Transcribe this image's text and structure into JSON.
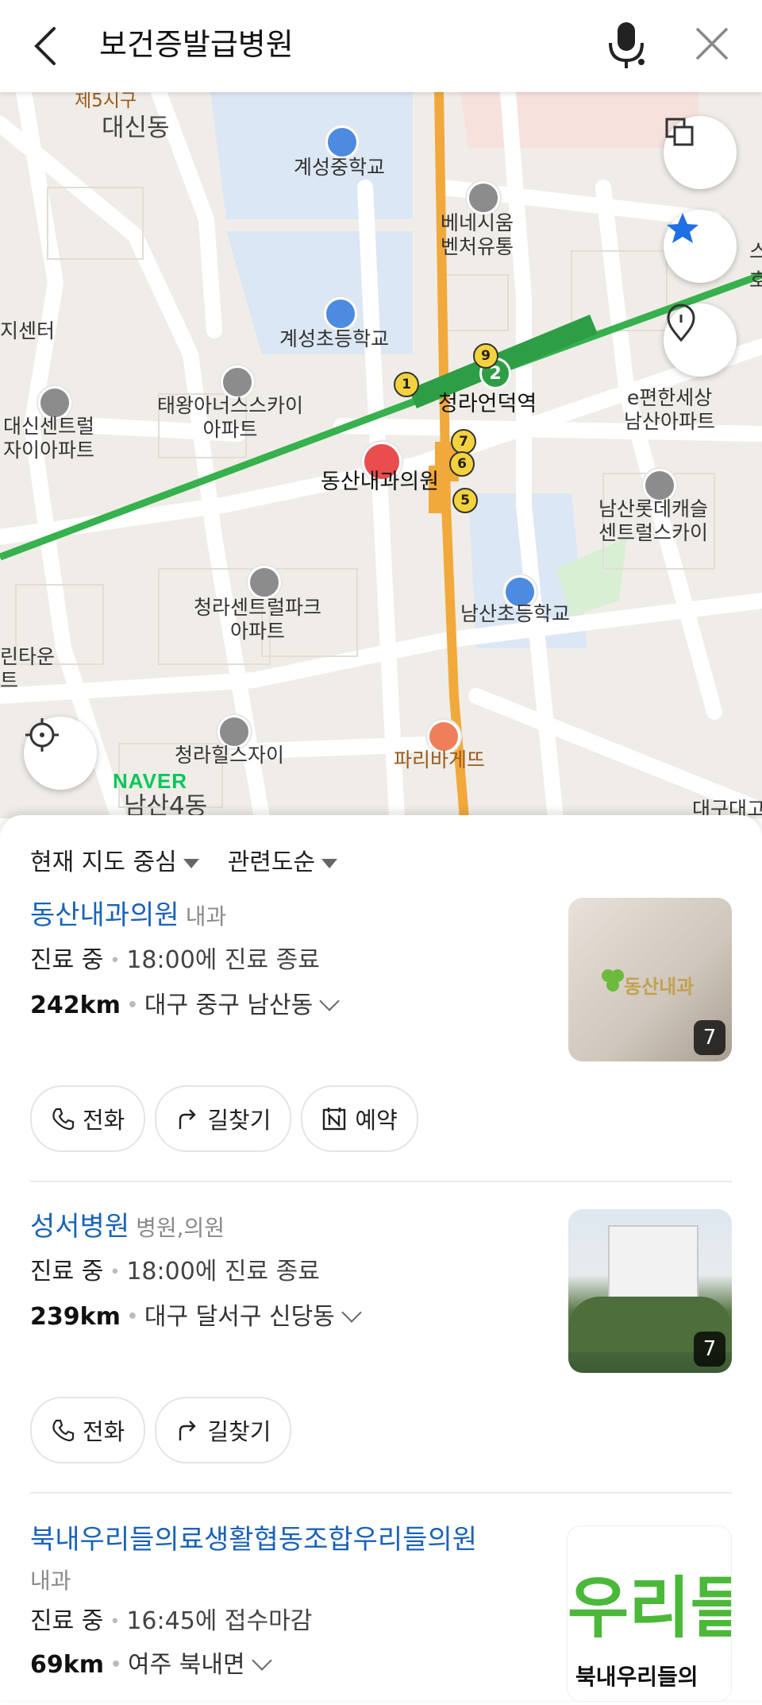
{
  "topbar": {
    "query": "보건증발급병원"
  },
  "map": {
    "labels": {
      "je5sigu": "제5시구",
      "daesindong": "대신동",
      "gyeseong_middle": "계성중학교",
      "benesium": "베네시움\n벤처유통",
      "jisenteo": "지센터",
      "gyeseong_elem": "계성초등학교",
      "taewang": "태왕아너스스카이\n아파트",
      "daesin_central": "대신센트럴\n자이아파트",
      "cheongna_station": "청라언덕역",
      "e_pyeonhan": "e편한세상\n남산아파트",
      "dongsan_clinic": "동산내과의원",
      "namsan_lotte": "남산롯데캐슬\n센트럴스카이",
      "cheongna_central": "청라센트럴파크\n아파트",
      "namsan_elem": "남산초등학교",
      "rin_town": "린타운\n트",
      "cheongna_hills": "청라힐스자이",
      "paris": "파리바게뜨",
      "namsan4": "남산4동",
      "daegu_right": "대구대고",
      "right_ho": "호",
      "right_s": "스"
    },
    "station_numbers": [
      "1",
      "2",
      "9",
      "7",
      "6",
      "5"
    ],
    "logo": "NAVER"
  },
  "sheet": {
    "filters": [
      {
        "label": "현재 지도 중심"
      },
      {
        "label": "관련도순"
      }
    ],
    "results": [
      {
        "name": "동산내과의원",
        "category": "내과",
        "status": "진료 중",
        "status_detail": "18:00에 진료 종료",
        "distance": "242km",
        "address": "대구 중구 남산동",
        "photo_count": "7",
        "thumb_text": "동산내과",
        "buttons": [
          "전화",
          "길찾기",
          "예약"
        ]
      },
      {
        "name": "성서병원",
        "category": "병원,의원",
        "status": "진료 중",
        "status_detail": "18:00에 진료 종료",
        "distance": "239km",
        "address": "대구 달서구 신당동",
        "photo_count": "7",
        "buttons": [
          "전화",
          "길찾기"
        ]
      },
      {
        "name": "북내우리들의료생활협동조합우리들의원",
        "category": "내과",
        "status": "진료 중",
        "status_detail": "16:45에 접수마감",
        "distance": "69km",
        "address": "여주 북내면",
        "thumb_big": "우리들",
        "thumb_small": "북내우리들의"
      }
    ]
  }
}
